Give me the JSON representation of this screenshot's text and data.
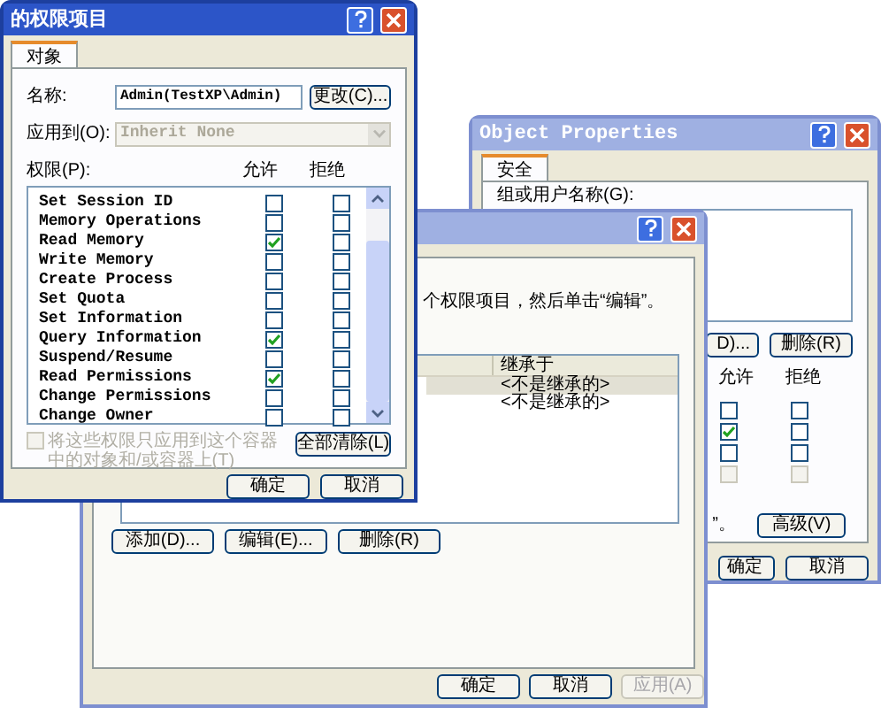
{
  "object_properties_window": {
    "title": "Object Properties",
    "tabs": [
      {
        "label": "安全",
        "selected": true
      }
    ],
    "group_label": "组或用户名称(G):",
    "buttons": [
      "D)...",
      "删除(R)"
    ],
    "columns": [
      "允许",
      "拒绝"
    ],
    "permissions": [
      {
        "allow": false,
        "deny": false,
        "disabled": false
      },
      {
        "allow": true,
        "deny": false,
        "disabled": false
      },
      {
        "allow": false,
        "deny": false,
        "disabled": false
      },
      {
        "allow": false,
        "deny": false,
        "disabled": true
      }
    ],
    "note": "”。",
    "advanced_button": "高级(V)",
    "footer_buttons": [
      "确定",
      "取消"
    ]
  },
  "permission_entries_window": {
    "instruction": "个权限项目，然后单击“编辑”。",
    "table": {
      "columns": [
        "继承于"
      ],
      "rows": [
        {
          "inherited_from": "<不是继承的>",
          "selected": true
        },
        {
          "inherited_from": "<不是继承的>",
          "selected": false
        }
      ]
    },
    "buttons": [
      "添加(D)...",
      "编辑(E)...",
      "删除(R)"
    ],
    "footer_buttons": [
      {
        "label": "确定",
        "disabled": false
      },
      {
        "label": "取消",
        "disabled": false
      },
      {
        "label": "应用(A)",
        "disabled": true
      }
    ]
  },
  "permission_entry_dialog": {
    "title": "的权限项目",
    "tabs": [
      {
        "label": "对象",
        "selected": true
      }
    ],
    "name_label": "名称:",
    "name_value": "Admin(TestXP\\Admin)",
    "change_button": "更改(C)...",
    "apply_to_label": "应用到(O):",
    "apply_to_value": "Inherit None",
    "apply_to_disabled": true,
    "permissions_label": "权限(P):",
    "columns": [
      "允许",
      "拒绝"
    ],
    "permissions": [
      {
        "name": "Set Session ID",
        "allow": false,
        "deny": false
      },
      {
        "name": "Memory Operations",
        "allow": false,
        "deny": false
      },
      {
        "name": "Read Memory",
        "allow": true,
        "deny": false
      },
      {
        "name": "Write Memory",
        "allow": false,
        "deny": false
      },
      {
        "name": "Create Process",
        "allow": false,
        "deny": false
      },
      {
        "name": "Set Quota",
        "allow": false,
        "deny": false
      },
      {
        "name": "Set Information",
        "allow": false,
        "deny": false
      },
      {
        "name": "Query Information",
        "allow": true,
        "deny": false
      },
      {
        "name": "Suspend/Resume",
        "allow": false,
        "deny": false
      },
      {
        "name": "Read Permissions",
        "allow": true,
        "deny": false
      },
      {
        "name": "Change Permissions",
        "allow": false,
        "deny": false
      },
      {
        "name": "Change Owner",
        "allow": false,
        "deny": false
      }
    ],
    "apply_only_checkbox": {
      "label": "将这些权限只应用到这个容器中的对象和/或容器上(T)",
      "checked": false,
      "disabled": true
    },
    "clear_all_button": "全部清除(L)",
    "footer_buttons": [
      "确定",
      "取消"
    ]
  }
}
